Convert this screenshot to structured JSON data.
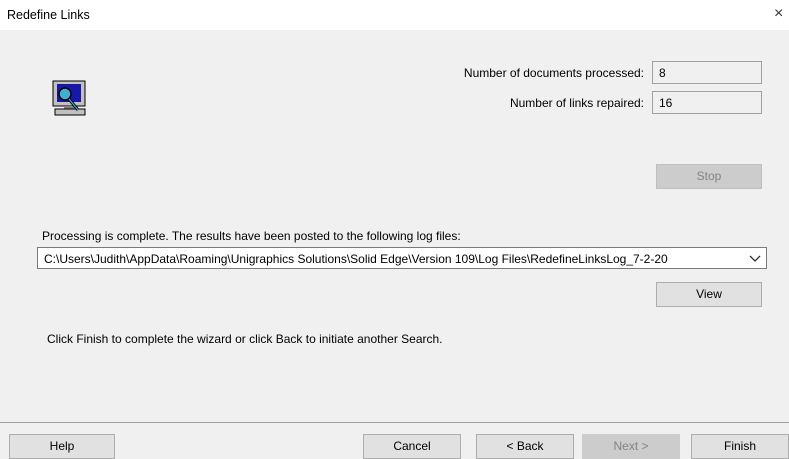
{
  "window": {
    "title": "Redefine Links",
    "close_glyph": "×"
  },
  "stats": {
    "docs_label": "Number of documents  processed:",
    "docs_value": "8",
    "links_label": "Number of links repaired:",
    "links_value": "16"
  },
  "buttons": {
    "stop": "Stop",
    "view": "View",
    "help": "Help",
    "cancel": "Cancel",
    "back": "< Back",
    "next": "Next >",
    "finish": "Finish"
  },
  "log": {
    "message": "Processing is complete.  The results have been posted to the following log files:",
    "selected_path": "C:\\Users\\Judith\\AppData\\Roaming\\Unigraphics Solutions\\Solid Edge\\Version 109\\Log Files\\RedefineLinksLog_7-2-20"
  },
  "instruction": "Click Finish to complete the wizard or click Back to initiate another Search.",
  "icons": {
    "computer": "computer-search-icon",
    "dropdown": "chevron-down-icon"
  }
}
